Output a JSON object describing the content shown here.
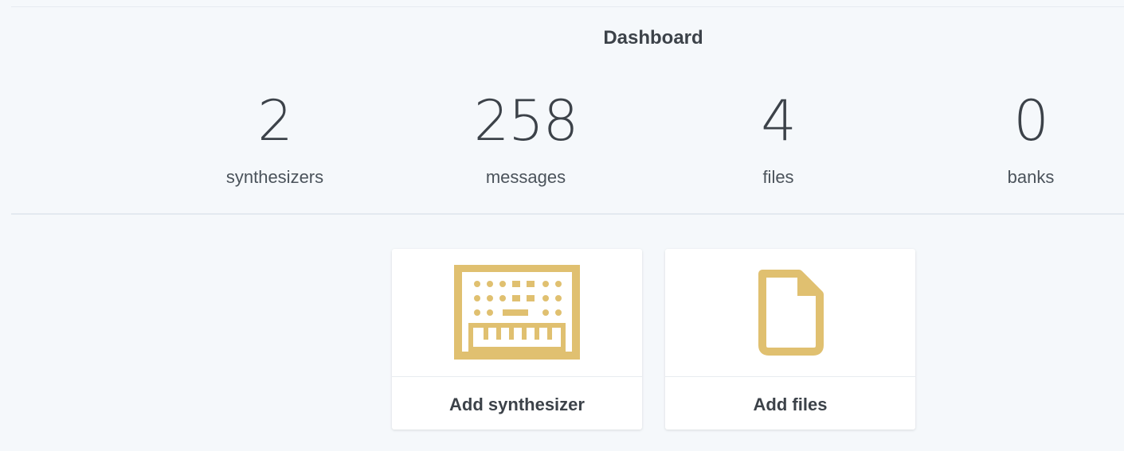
{
  "dashboard": {
    "title": "Dashboard",
    "accent_color": "#e0c070"
  },
  "stats": [
    {
      "value": "2",
      "label": "synthesizers"
    },
    {
      "value": "258",
      "label": "messages"
    },
    {
      "value": "4",
      "label": "files"
    },
    {
      "value": "0",
      "label": "banks"
    }
  ],
  "actions": [
    {
      "label": "Add synthesizer",
      "icon": "synthesizer-icon"
    },
    {
      "label": "Add files",
      "icon": "file-icon"
    }
  ]
}
